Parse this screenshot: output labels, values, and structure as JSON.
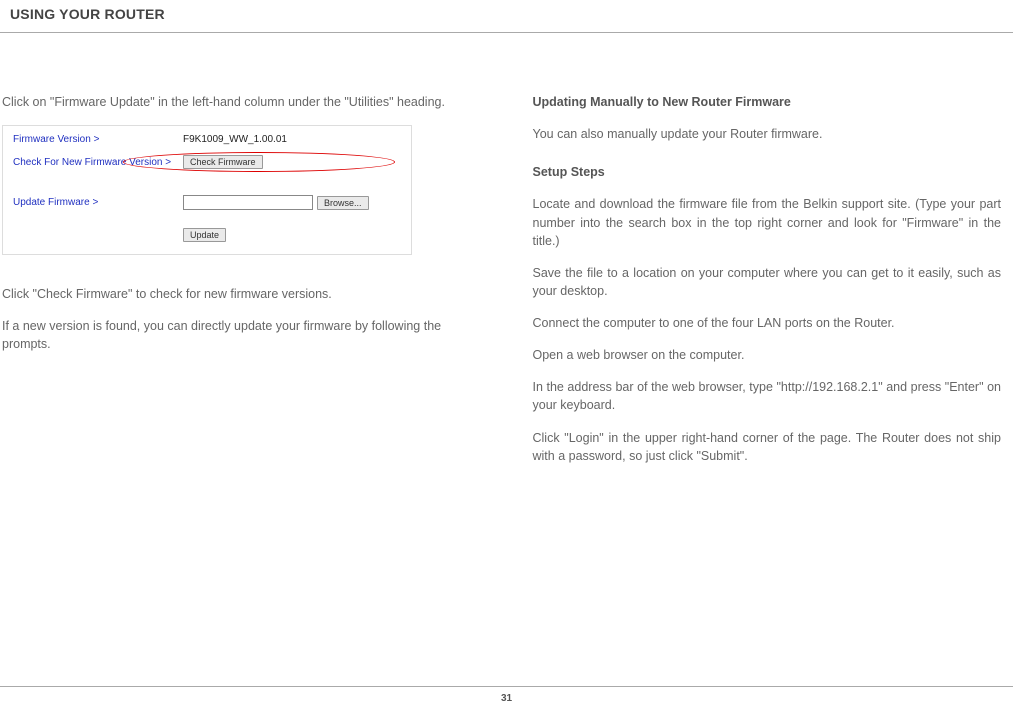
{
  "header": {
    "title": "USING YOUR ROUTER"
  },
  "left": {
    "intro1": "Click on \"Firmware Update\" in the left-hand column under the \"Utilities\" heading.",
    "fw": {
      "label_version": "Firmware Version >",
      "value_version": "F9K1009_WW_1.00.01",
      "label_check": "Check For New Firmware Version >",
      "btn_check": "Check Firmware",
      "label_update": "Update Firmware >",
      "btn_browse": "Browse...",
      "btn_update": "Update"
    },
    "p2": "Click \"Check Firmware\" to check for new firmware versions.",
    "p3": "If a new version is found, you can directly update your firmware by following the prompts."
  },
  "right": {
    "h1": "Updating Manually to New Router Firmware",
    "p1": "You can also manually update your Router firmware.",
    "h2": "Setup Steps",
    "p2": "Locate and download the firmware file from the Belkin support site. (Type your part number into the search box in the top right corner and look for \"Firmware\" in the title.)",
    "p3": "Save the file to a location on your computer where you can get to it easily, such as your desktop.",
    "p4": "Connect the computer to one of the four LAN ports on the Router.",
    "p5": "Open a web browser on the computer.",
    "p6": "In the address bar of the web browser, type \"http://192.168.2.1\" and press \"Enter\" on your keyboard.",
    "p7": "Click \"Login\" in the upper right-hand corner of the page. The Router does not ship with a password, so just click \"Submit\"."
  },
  "footer": {
    "page": "31"
  }
}
